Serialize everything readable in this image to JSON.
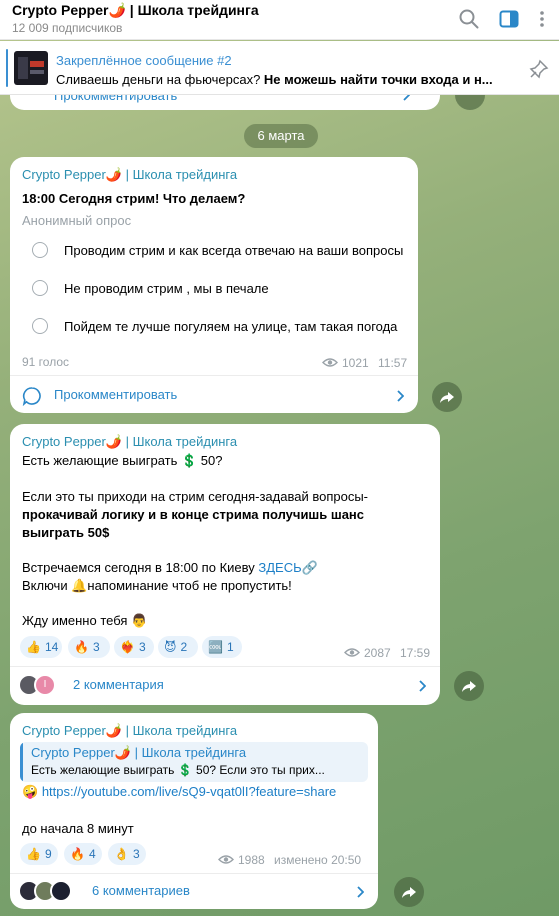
{
  "header": {
    "title": "Crypto Pepper🌶️ | Школа трейдинга",
    "subscribers": "12 009 подписчиков"
  },
  "pinned": {
    "title": "Закреплённое сообщение #2",
    "text_plain": "Сливаешь деньги на фьючерсах? ",
    "text_bold": "Не можешь найти точки входа и н..."
  },
  "top_partial": {
    "comment_label": "Прокомментировать"
  },
  "date_chip": "6 марта",
  "poll_post": {
    "author": "Crypto Pepper🌶️ | Школа трейдинга",
    "question": "18:00 Сегодня стрим! Что делаем?",
    "poll_type": "Анонимный опрос",
    "options": [
      "Проводим стрим и как всегда отвечаю на ваши вопросы",
      "Не проводим стрим , мы в печале",
      "Пойдем те лучше погуляем на улице, там такая погода"
    ],
    "votes": "91 голос",
    "views": "1021",
    "time": "11:57",
    "comment_label": "Прокомментировать"
  },
  "giveaway_post": {
    "author": "Crypto Pepper🌶️ | Школа трейдинга",
    "line1": "Есть желающие выиграть 💲 50?",
    "line2": "Если это ты приходи на стрим сегодня-задавай вопросы-",
    "line3": "прокачивай логику и в конце стрима получишь шанс",
    "line4": "выиграть 50$",
    "line5_prefix": "Встречаемся сегодня в 18:00 по Киеву ",
    "line5_link": "ЗДЕСЬ🔗",
    "line6": "Включи 🔔напоминание чтоб не пропустить!",
    "line7": "Жду именно тебя 👨",
    "reactions": [
      {
        "emoji": "👍",
        "count": "14"
      },
      {
        "emoji": "🔥",
        "count": "3"
      },
      {
        "emoji": "❤️‍🔥",
        "count": "3"
      },
      {
        "emoji": "😈",
        "count": "2"
      },
      {
        "emoji": "🆒",
        "count": "1"
      }
    ],
    "views": "2087",
    "time": "17:59",
    "comment_label": "2 комментария",
    "avatar_letter": "I"
  },
  "stream_post": {
    "author": "Crypto Pepper🌶️ | Школа трейдинга",
    "quote_author": "Crypto Pepper🌶️ | Школа трейдинга",
    "quote_text": "Есть желающие выиграть 💲 50?  Если это ты прих...",
    "link_emoji": "🤪",
    "link": "https://youtube.com/live/sQ9-vqat0lI?feature=share",
    "text": "до начала 8 минут",
    "reactions": [
      {
        "emoji": "👍",
        "count": "9"
      },
      {
        "emoji": "🔥",
        "count": "4"
      },
      {
        "emoji": "👌",
        "count": "3"
      }
    ],
    "views": "1988",
    "time": "изменено 20:50",
    "comment_label": "6 комментариев"
  },
  "colors": {
    "accent": "#2a87c8",
    "author": "#2b8fb0",
    "reaction_bg": "#e8f2fb"
  }
}
